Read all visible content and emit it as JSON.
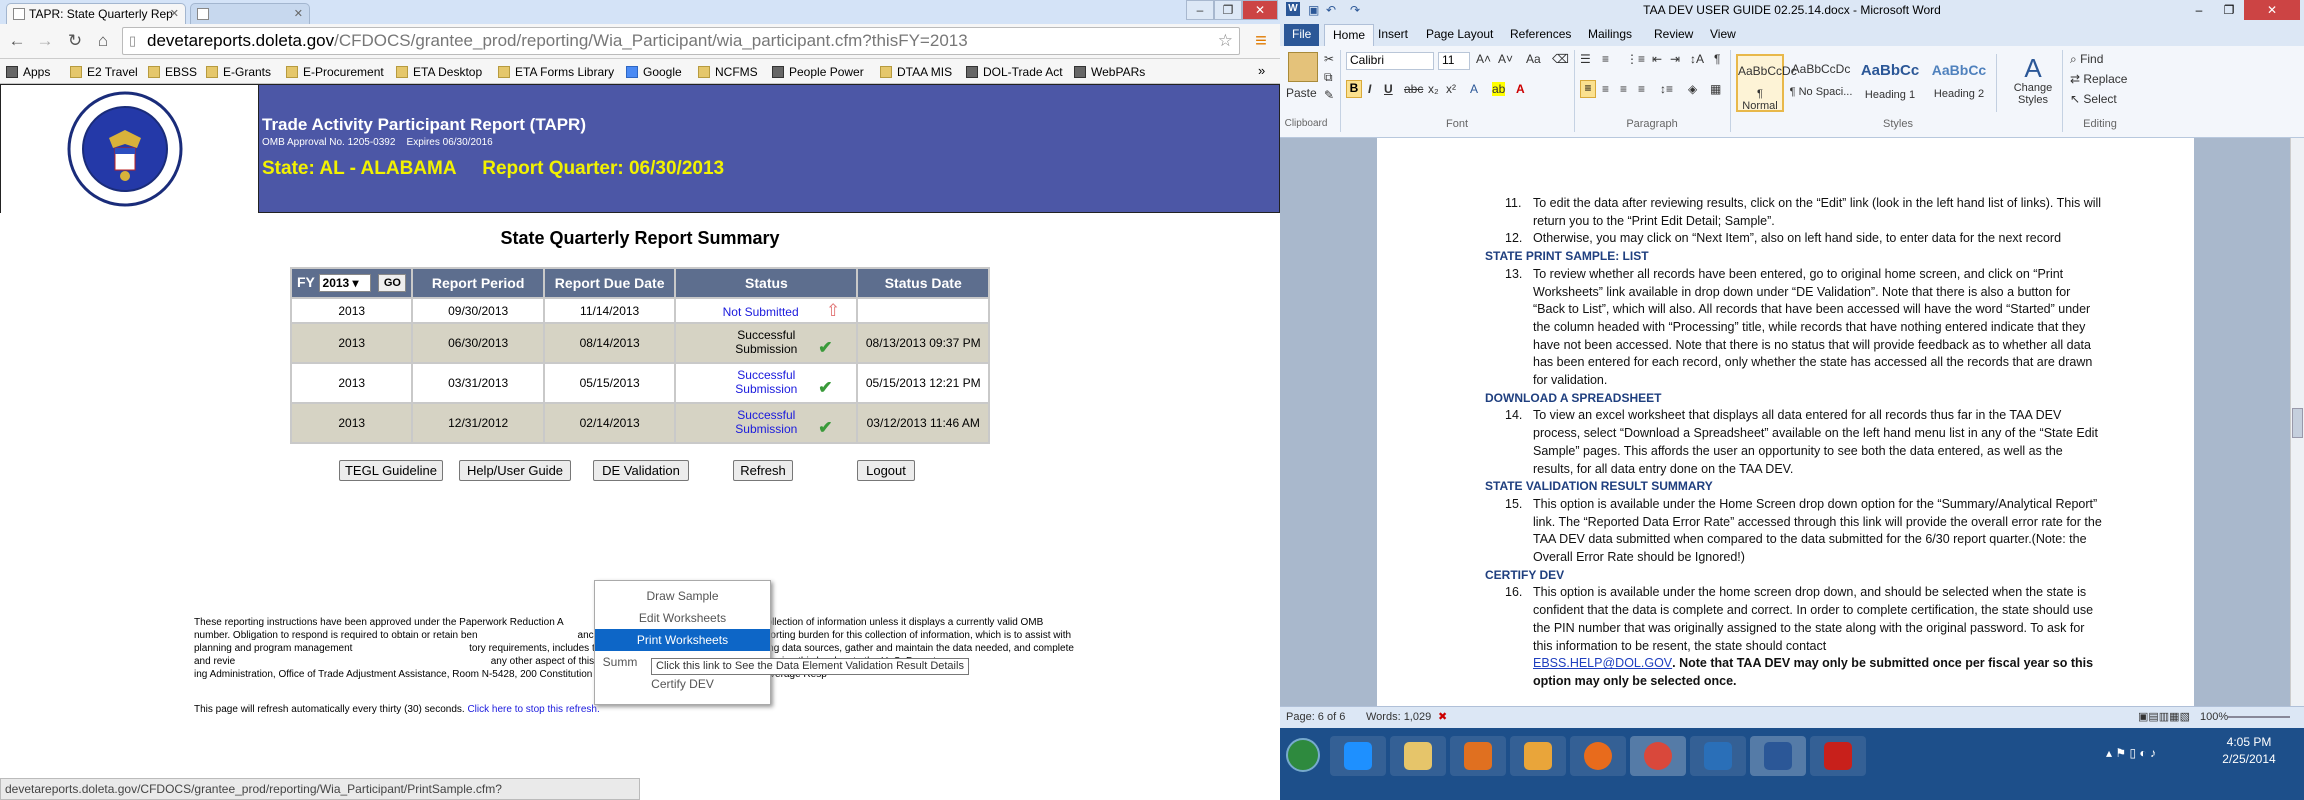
{
  "chrome": {
    "tabs": [
      {
        "label": "TAPR: State Quarterly Rep"
      },
      {
        "label": ""
      }
    ],
    "url_host": "devetareports.doleta.gov",
    "url_path": "/CFDOCS/grantee_prod/reporting/Wia_Participant/wia_participant.cfm?thisFY=2013",
    "bookmarks": [
      "Apps",
      "E2 Travel",
      "EBSS",
      "E-Grants",
      "E-Procurement",
      "ETA Desktop",
      "ETA Forms Library",
      "Google",
      "NCFMS",
      "People Power",
      "DTAA MIS",
      "DOL-Trade Act",
      "WebPARs"
    ],
    "status_url": "devetareports.doleta.gov/CFDOCS/grantee_prod/reporting/Wia_Participant/PrintSample.cfm?report_period=06/30/2013"
  },
  "header": {
    "title": "Trade Activity Participant Report (TAPR)",
    "omb": "OMB Approval No. 1205-0392    Expires 06/30/2016",
    "state": "State: AL - ALABAMA     Report Quarter: 06/30/2013"
  },
  "summary_title": "State Quarterly Report Summary",
  "table": {
    "fy_label": "FY",
    "fy_value": "2013",
    "go_label": "GO",
    "headers": [
      "Report Period",
      "Report Due Date",
      "Status",
      "Status Date"
    ],
    "rows": [
      {
        "fy": "2013",
        "period": "09/30/2013",
        "due": "11/14/2013",
        "status": "Not Submitted",
        "date": ""
      },
      {
        "fy": "2013",
        "period": "06/30/2013",
        "due": "08/14/2013",
        "status": "Successful Submission",
        "date": "08/13/2013 09:37 PM"
      },
      {
        "fy": "2013",
        "period": "03/31/2013",
        "due": "05/15/2013",
        "status": "Successful Submission",
        "date": "05/15/2013 12:21 PM"
      },
      {
        "fy": "2013",
        "period": "12/31/2012",
        "due": "02/14/2013",
        "status": "Successful Submission",
        "date": "03/12/2013 11:46 AM"
      }
    ]
  },
  "buttons": [
    "TEGL Guideline",
    "Help/User Guide",
    "DE Validation",
    "Refresh",
    "Logout"
  ],
  "dropdown": [
    "Draw Sample",
    "Edit Worksheets",
    "Print Worksheets",
    "Summ",
    "Certify DEV"
  ],
  "tooltip": "Click this link to See the Data Element Validation Result Details",
  "disclaimer": "These reporting instructions have been approved under the Paperwork Reduction A                                         l to respond to this collection of information unless it displays a currently valid OMB number. Obligation to respond is required to obtain or retain ben                                    ance Program (20 CFR 617. 61). Public reporting burden for this collection of information, which is to assist with planning and program management                                          tory requirements, includes time to review instructions, search existing data sources, gather and maintain the data needed, and complete and revie                                                                                            any other aspect of this collection, including suggestions for reducing this burden, to the U. S. Depart                                                      ing Administration, Office of Trade Adjustment Assistance, Room N-5428, 200 Constitution Avenue, NW, Washington, DC 20210. Average Resp",
  "refresh_text": "This page will refresh automatically every thirty (30) seconds.",
  "refresh_link": "Click here to stop this refresh.",
  "word": {
    "title": "TAA DEV USER GUIDE 02.25.14.docx - Microsoft Word",
    "tabs": [
      "File",
      "Home",
      "Insert",
      "Page Layout",
      "References",
      "Mailings",
      "Review",
      "View"
    ],
    "font_name": "Calibri",
    "font_size": "11",
    "styles": [
      {
        "preview": "AaBbCcDc",
        "name": "¶ Normal"
      },
      {
        "preview": "AaBbCcDc",
        "name": "¶ No Spaci..."
      },
      {
        "preview": "AaBbCc",
        "name": "Heading 1"
      },
      {
        "preview": "AaBbCc",
        "name": "Heading 2"
      }
    ],
    "change_styles": "Change Styles",
    "editing": [
      "Find",
      "Replace",
      "Select"
    ],
    "group_labels": [
      "Clipboard",
      "Font",
      "Paragraph",
      "Styles",
      "Editing"
    ],
    "paste": "Paste",
    "doc": [
      {
        "n": "11.",
        "text": "To edit the data after reviewing results, click on the “Edit” link (look in the left hand list of links).  This will return you to the “Print Edit Detail; Sample”."
      },
      {
        "n": "12.",
        "text": "Otherwise, you may click on “Next Item”, also on left hand side, to enter data for the next record"
      },
      {
        "h": "STATE PRINT SAMPLE: LIST"
      },
      {
        "n": "13.",
        "text": "To review whether all records have been entered, go to original home screen, and click on “Print Worksheets” link available in drop down under “DE Validation”. Note that there is also a button for “Back to List”, which will also.  All records that have been accessed will have the word “Started” under the column headed with “Processing” title, while records that have nothing entered indicate that they have not been accessed. Note that there is no status that will provide feedback as to whether all data has been entered for each record, only whether the state has accessed all the records that are drawn for validation."
      },
      {
        "h": "DOWNLOAD A SPREADSHEET"
      },
      {
        "n": "14.",
        "text": "To view an excel worksheet that displays all data entered for all records thus far in the TAA DEV process, select “Download a Spreadsheet” available on the left hand menu list in any of the “State Edit Sample” pages.  This affords the user an opportunity to see both the data entered, as well as the results, for all data entry done on the TAA DEV."
      },
      {
        "h": "STATE VALIDATION RESULT SUMMARY"
      },
      {
        "n": "15.",
        "text": "This option is available under the Home Screen drop down option for the  “Summary/Analytical Report” link. The “Reported Data Error Rate” accessed through this link will provide the overall error rate for the TAA DEV data submitted when compared to the data submitted for the 6/30 report quarter.(Note: the Overall Error Rate should be Ignored!)"
      },
      {
        "h": "CERTIFY DEV"
      },
      {
        "n": "16.",
        "text": "This option is available under the home screen drop down, and should be selected when the state is confident that the data is complete and correct. In order to complete certification, the state should use the PIN number that was originally assigned to the state along with the original password. To ask for this information to be resent, the state should contact"
      },
      {
        "email": "EBSS.HELP@DOL.GOV",
        "bold": ". Note that TAA DEV may only be submitted once per fiscal year so this option may only be selected once."
      }
    ],
    "status_page": "Page: 6 of 6",
    "status_words": "Words: 1,029",
    "zoom": "100%"
  },
  "taskbar": {
    "time": "4:05 PM",
    "date": "2/25/2014"
  }
}
